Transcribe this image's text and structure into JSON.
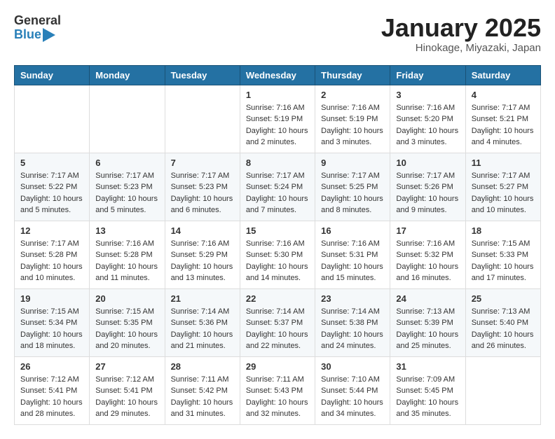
{
  "header": {
    "logo_general": "General",
    "logo_blue": "Blue",
    "month_title": "January 2025",
    "subtitle": "Hinokage, Miyazaki, Japan"
  },
  "weekdays": [
    "Sunday",
    "Monday",
    "Tuesday",
    "Wednesday",
    "Thursday",
    "Friday",
    "Saturday"
  ],
  "weeks": [
    [
      {
        "day": "",
        "info": ""
      },
      {
        "day": "",
        "info": ""
      },
      {
        "day": "",
        "info": ""
      },
      {
        "day": "1",
        "info": "Sunrise: 7:16 AM\nSunset: 5:19 PM\nDaylight: 10 hours and 2 minutes."
      },
      {
        "day": "2",
        "info": "Sunrise: 7:16 AM\nSunset: 5:19 PM\nDaylight: 10 hours and 3 minutes."
      },
      {
        "day": "3",
        "info": "Sunrise: 7:16 AM\nSunset: 5:20 PM\nDaylight: 10 hours and 3 minutes."
      },
      {
        "day": "4",
        "info": "Sunrise: 7:17 AM\nSunset: 5:21 PM\nDaylight: 10 hours and 4 minutes."
      }
    ],
    [
      {
        "day": "5",
        "info": "Sunrise: 7:17 AM\nSunset: 5:22 PM\nDaylight: 10 hours and 5 minutes."
      },
      {
        "day": "6",
        "info": "Sunrise: 7:17 AM\nSunset: 5:23 PM\nDaylight: 10 hours and 5 minutes."
      },
      {
        "day": "7",
        "info": "Sunrise: 7:17 AM\nSunset: 5:23 PM\nDaylight: 10 hours and 6 minutes."
      },
      {
        "day": "8",
        "info": "Sunrise: 7:17 AM\nSunset: 5:24 PM\nDaylight: 10 hours and 7 minutes."
      },
      {
        "day": "9",
        "info": "Sunrise: 7:17 AM\nSunset: 5:25 PM\nDaylight: 10 hours and 8 minutes."
      },
      {
        "day": "10",
        "info": "Sunrise: 7:17 AM\nSunset: 5:26 PM\nDaylight: 10 hours and 9 minutes."
      },
      {
        "day": "11",
        "info": "Sunrise: 7:17 AM\nSunset: 5:27 PM\nDaylight: 10 hours and 10 minutes."
      }
    ],
    [
      {
        "day": "12",
        "info": "Sunrise: 7:17 AM\nSunset: 5:28 PM\nDaylight: 10 hours and 10 minutes."
      },
      {
        "day": "13",
        "info": "Sunrise: 7:16 AM\nSunset: 5:28 PM\nDaylight: 10 hours and 11 minutes."
      },
      {
        "day": "14",
        "info": "Sunrise: 7:16 AM\nSunset: 5:29 PM\nDaylight: 10 hours and 13 minutes."
      },
      {
        "day": "15",
        "info": "Sunrise: 7:16 AM\nSunset: 5:30 PM\nDaylight: 10 hours and 14 minutes."
      },
      {
        "day": "16",
        "info": "Sunrise: 7:16 AM\nSunset: 5:31 PM\nDaylight: 10 hours and 15 minutes."
      },
      {
        "day": "17",
        "info": "Sunrise: 7:16 AM\nSunset: 5:32 PM\nDaylight: 10 hours and 16 minutes."
      },
      {
        "day": "18",
        "info": "Sunrise: 7:15 AM\nSunset: 5:33 PM\nDaylight: 10 hours and 17 minutes."
      }
    ],
    [
      {
        "day": "19",
        "info": "Sunrise: 7:15 AM\nSunset: 5:34 PM\nDaylight: 10 hours and 18 minutes."
      },
      {
        "day": "20",
        "info": "Sunrise: 7:15 AM\nSunset: 5:35 PM\nDaylight: 10 hours and 20 minutes."
      },
      {
        "day": "21",
        "info": "Sunrise: 7:14 AM\nSunset: 5:36 PM\nDaylight: 10 hours and 21 minutes."
      },
      {
        "day": "22",
        "info": "Sunrise: 7:14 AM\nSunset: 5:37 PM\nDaylight: 10 hours and 22 minutes."
      },
      {
        "day": "23",
        "info": "Sunrise: 7:14 AM\nSunset: 5:38 PM\nDaylight: 10 hours and 24 minutes."
      },
      {
        "day": "24",
        "info": "Sunrise: 7:13 AM\nSunset: 5:39 PM\nDaylight: 10 hours and 25 minutes."
      },
      {
        "day": "25",
        "info": "Sunrise: 7:13 AM\nSunset: 5:40 PM\nDaylight: 10 hours and 26 minutes."
      }
    ],
    [
      {
        "day": "26",
        "info": "Sunrise: 7:12 AM\nSunset: 5:41 PM\nDaylight: 10 hours and 28 minutes."
      },
      {
        "day": "27",
        "info": "Sunrise: 7:12 AM\nSunset: 5:41 PM\nDaylight: 10 hours and 29 minutes."
      },
      {
        "day": "28",
        "info": "Sunrise: 7:11 AM\nSunset: 5:42 PM\nDaylight: 10 hours and 31 minutes."
      },
      {
        "day": "29",
        "info": "Sunrise: 7:11 AM\nSunset: 5:43 PM\nDaylight: 10 hours and 32 minutes."
      },
      {
        "day": "30",
        "info": "Sunrise: 7:10 AM\nSunset: 5:44 PM\nDaylight: 10 hours and 34 minutes."
      },
      {
        "day": "31",
        "info": "Sunrise: 7:09 AM\nSunset: 5:45 PM\nDaylight: 10 hours and 35 minutes."
      },
      {
        "day": "",
        "info": ""
      }
    ]
  ]
}
